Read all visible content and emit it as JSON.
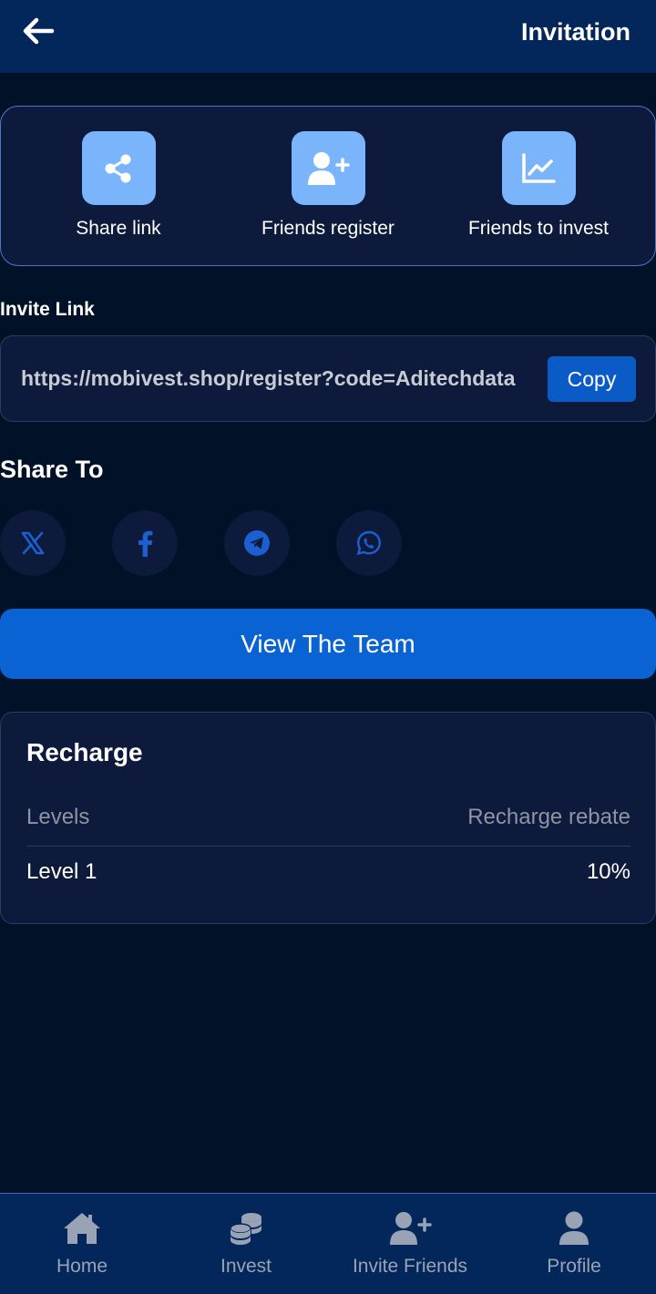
{
  "header": {
    "title": "Invitation",
    "back_icon": "arrow-left-icon"
  },
  "steps": [
    {
      "label": "Share link",
      "icon": "share-icon"
    },
    {
      "label": "Friends register",
      "icon": "user-plus-icon"
    },
    {
      "label": "Friends to invest",
      "icon": "line-chart-icon"
    }
  ],
  "invite": {
    "label": "Invite Link",
    "link": "https://mobivest.shop/register?code=Aditechdata",
    "copy_label": "Copy"
  },
  "share": {
    "title": "Share To",
    "networks": [
      {
        "name": "x",
        "icon": "x-twitter-icon"
      },
      {
        "name": "facebook",
        "icon": "facebook-icon"
      },
      {
        "name": "telegram",
        "icon": "telegram-icon"
      },
      {
        "name": "whatsapp",
        "icon": "whatsapp-icon"
      }
    ]
  },
  "view_team_label": "View The Team",
  "recharge": {
    "title": "Recharge",
    "columns": [
      "Levels",
      "Recharge rebate"
    ],
    "rows": [
      {
        "level": "Level 1",
        "rebate": "10%"
      }
    ]
  },
  "nav": {
    "items": [
      {
        "label": "Home",
        "icon": "home-icon"
      },
      {
        "label": "Invest",
        "icon": "coins-icon"
      },
      {
        "label": "Invite Friends",
        "icon": "user-plus-icon"
      },
      {
        "label": "Profile",
        "icon": "user-icon"
      }
    ]
  },
  "colors": {
    "background": "#011127",
    "header": "#03275a",
    "card": "#0d1a3b",
    "accent": "#0a63d2",
    "icon_box": "#7ab4fb",
    "social_icon": "#1b5fd0"
  }
}
